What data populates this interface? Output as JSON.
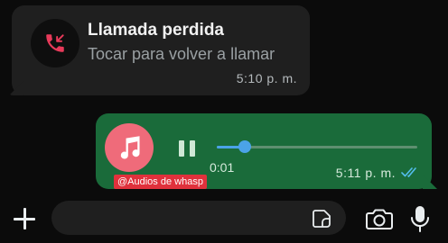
{
  "missed_call": {
    "title": "Llamada perdida",
    "subtitle": "Tocar para volver a llamar",
    "time": "5:10 p. m."
  },
  "audio_message": {
    "elapsed": "0:01",
    "time": "5:11 p. m.",
    "progress": 0.14,
    "watermark": "@Audios de whasp"
  },
  "input": {
    "placeholder": ""
  },
  "colors": {
    "background": "#0b0b0b",
    "incoming_bubble": "#1f1f1f",
    "outgoing_bubble": "#1a6b3a",
    "missed_call_red": "#e83a5a",
    "audio_avatar": "#ef6b7a",
    "read_ticks": "#53bdeb"
  },
  "icons": [
    "missed-call-icon",
    "music-note-icon",
    "pause-icon",
    "double-check-icon",
    "plus-icon",
    "sticker-icon",
    "camera-icon",
    "microphone-icon"
  ]
}
